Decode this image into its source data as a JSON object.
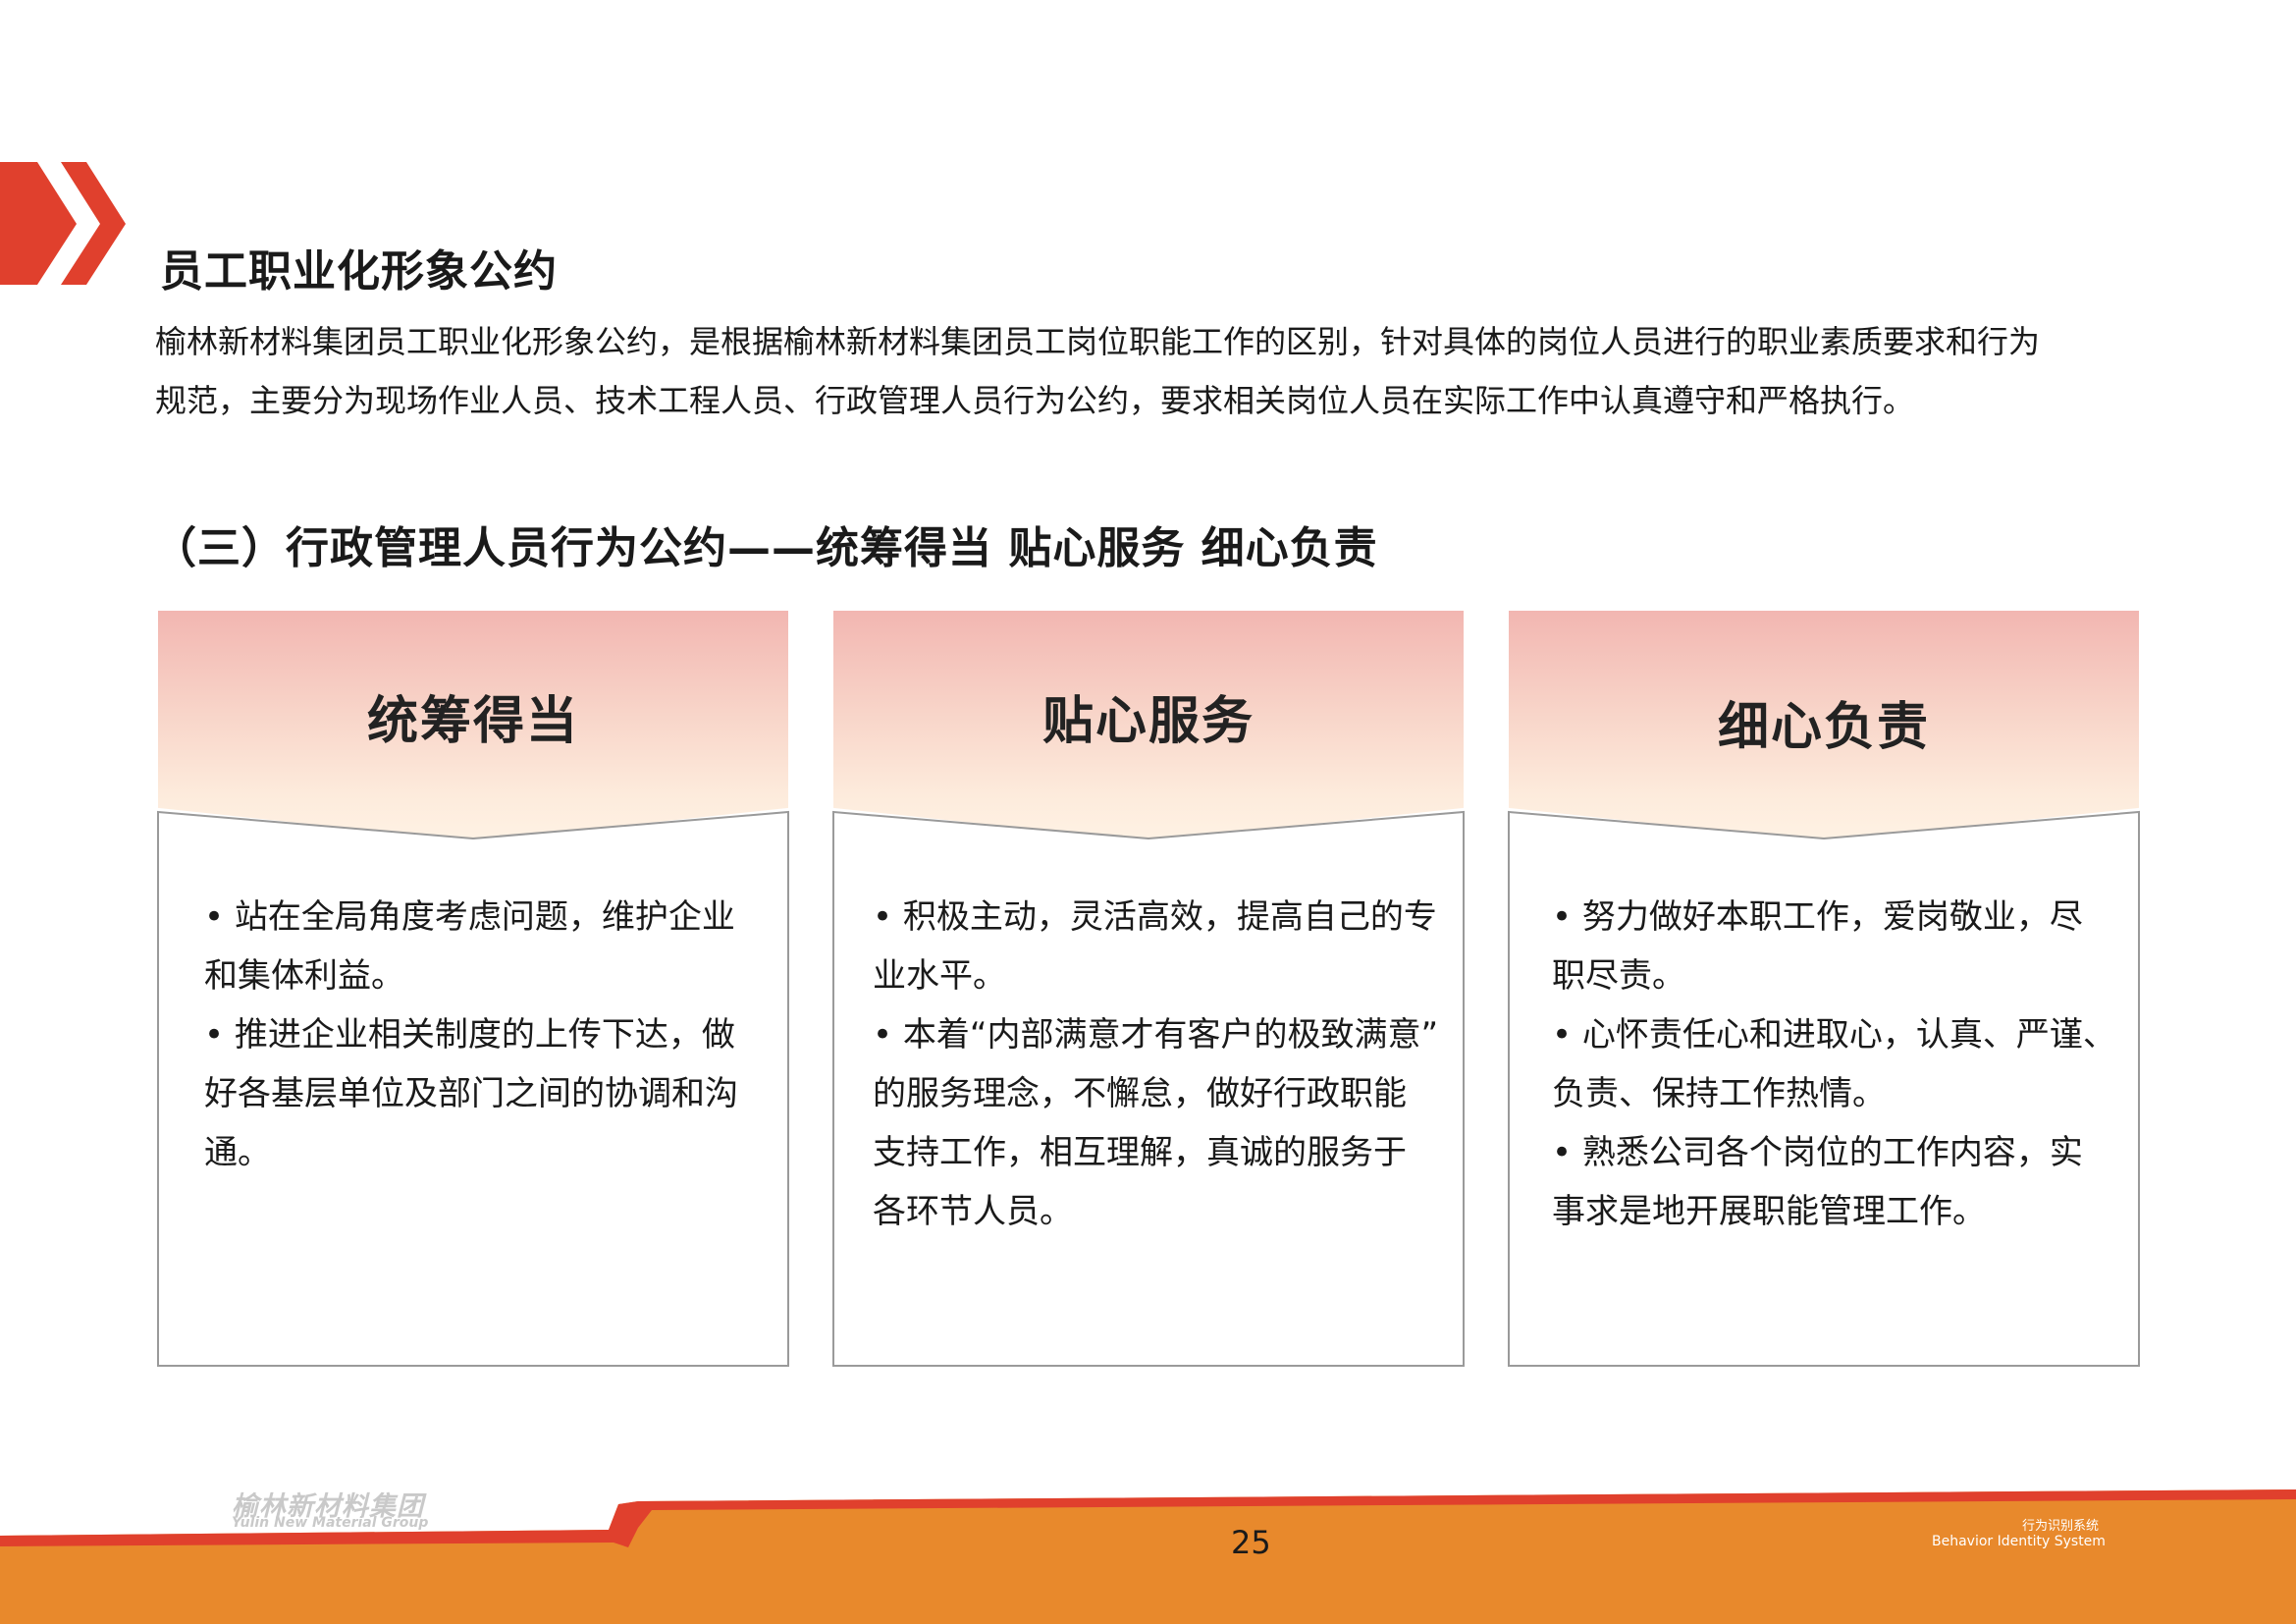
{
  "section": {
    "title": "员工职业化形象公约",
    "intro_line1": "榆林新材料集团员工职业化形象公约，是根据榆林新材料集团员工岗位职能工作的区别，针对具体的岗位人员进行的职业素质要求和行为",
    "intro_line2": "规范，主要分为现场作业人员、技术工程人员、行政管理人员行为公约，要求相关岗位人员在实际工作中认真遵守和严格执行。"
  },
  "subsection": {
    "title": "（三）行政管理人员行为公约——统筹得当  贴心服务  细心负责"
  },
  "cards": [
    {
      "title": "统筹得当",
      "lines": [
        "• 站在全局角度考虑问题，维护企业",
        "和集体利益。",
        "• 推进企业相关制度的上传下达，做",
        "好各基层单位及部门之间的协调和沟",
        "通。"
      ]
    },
    {
      "title": "贴心服务",
      "lines": [
        "• 积极主动，灵活高效，提高自己的专",
        "业水平。",
        "• 本着“内部满意才有客户的极致满意”",
        "的服务理念，不懈怠，做好行政职能",
        "支持工作，相互理解，真诚的服务于",
        "各环节人员。"
      ]
    },
    {
      "title": "细心负责",
      "lines": [
        "• 努力做好本职工作，爱岗敬业，尽",
        "职尽责。",
        "• 心怀责任心和进取心，认真、严谨、",
        "负责、保持工作热情。",
        "• 熟悉公司各个岗位的工作内容，实",
        "事求是地开展职能管理工作。"
      ]
    }
  ],
  "footer": {
    "logo_cn": "榆林新材料集团",
    "logo_en": "Yulin New Material Group",
    "page_number": "25",
    "system_cn": "行为识别系统",
    "system_en": "Behavior Identity System"
  },
  "colors": {
    "accent_red": "#e0402d",
    "footer_orange": "#e8892c",
    "card_border": "#9a9a9a"
  }
}
